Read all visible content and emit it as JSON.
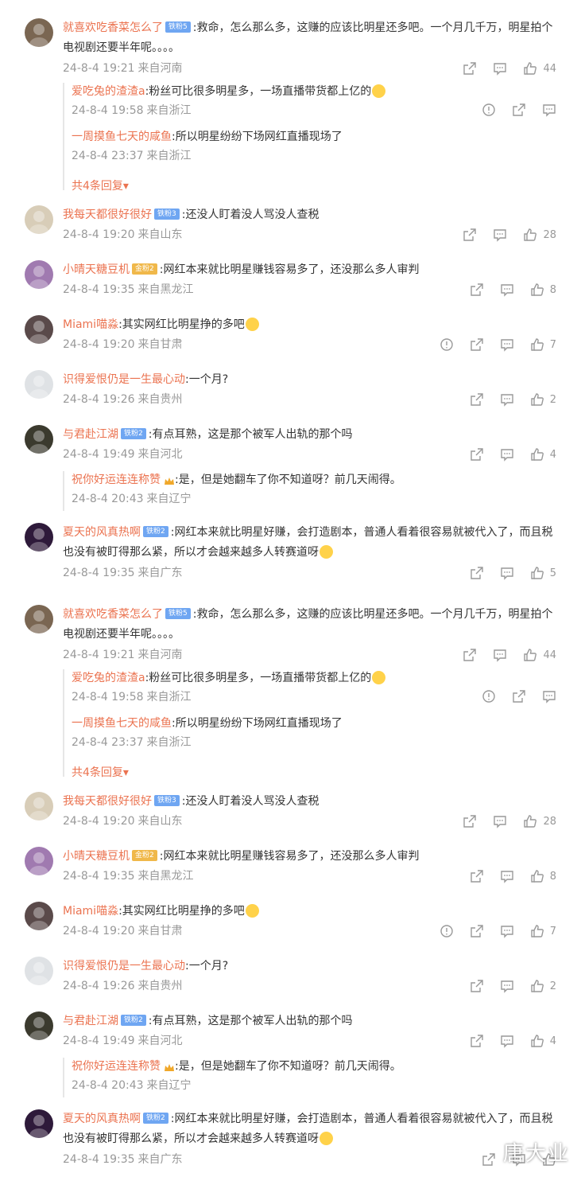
{
  "labels": {
    "more_replies": "共4条回复▾"
  },
  "blocks": [
    {
      "user": "就喜欢吃香菜怎么了",
      "badge": "铁粉5",
      "badge_type": "blue",
      "text": ":救命，怎么那么多，这赚的应该比明星还多吧。一个月几千万，明星拍个电视剧还要半年呢。。。。",
      "date": "24-8-4 19:21",
      "place": "来自河南",
      "likes": "44",
      "avatar_color": "#7a6652",
      "replies": [
        {
          "user": "爱吃兔的渣渣a",
          "text": ":粉丝可比很多明星多，一场直播带货都上亿的",
          "emoji": true,
          "date": "24-8-4 19:58",
          "place": "来自浙江"
        },
        {
          "user": "一周摸鱼七天的咸鱼",
          "text": ":所以明星纷纷下场网红直播现场了",
          "date": "24-8-4 23:37",
          "place": "来自浙江"
        }
      ],
      "more": true
    },
    {
      "user": "我每天都很好很好",
      "badge": "铁粉3",
      "badge_type": "blue",
      "text": ":还没人盯着没人骂没人查税",
      "date": "24-8-4 19:20",
      "place": "来自山东",
      "likes": "28",
      "avatar_color": "#d8cdb8"
    },
    {
      "user": "小晴天糖豆机",
      "badge": "金粉2",
      "badge_type": "gold",
      "text": ":网红本来就比明星赚钱容易多了，还没那么多人审判",
      "date": "24-8-4 19:35",
      "place": "来自黑龙江",
      "likes": "8",
      "avatar_color": "#a07ab0"
    },
    {
      "user": "Miami喵淼",
      "text": ":其实网红比明星挣的多吧",
      "emoji": true,
      "date": "24-8-4 19:20",
      "place": "来自甘肃",
      "likes": "7",
      "avatar_color": "#5a4a4a"
    },
    {
      "user": "识得爱恨仍是一生最心动",
      "text": ":一个月?",
      "date": "24-8-4 19:26",
      "place": "来自贵州",
      "likes": "2",
      "avatar_color": "#dfe2e5"
    },
    {
      "user": "与君赴江湖",
      "badge": "铁粉2",
      "badge_type": "blue",
      "text": ":有点耳熟，这是那个被军人出轨的那个吗",
      "date": "24-8-4 19:49",
      "place": "来自河北",
      "likes": "4",
      "avatar_color": "#3b3a2e",
      "replies": [
        {
          "user": "祝你好运连连称赞",
          "crown": true,
          "text": ":是，但是她翻车了你不知道呀？前几天闹得。",
          "date": "24-8-4 20:43",
          "place": "来自辽宁"
        }
      ]
    },
    {
      "user": "夏天的风真热啊",
      "badge": "铁粉2",
      "badge_type": "blue",
      "text": ":网红本来就比明星好赚，会打造剧本，普通人看着很容易就被代入了，而且税也没有被盯得那么紧，所以才会越来越多人转赛道呀",
      "emoji": true,
      "date": "24-8-4 19:35",
      "place": "来自广东",
      "likes": "5",
      "avatar_color": "#2e1a3a"
    },
    {
      "user": "就喜欢吃香菜怎么了",
      "badge": "铁粉5",
      "badge_type": "blue",
      "text": ":救命，怎么那么多，这赚的应该比明星还多吧。一个月几千万，明星拍个电视剧还要半年呢。。。。",
      "date": "24-8-4 19:21",
      "place": "来自河南",
      "likes": "44",
      "avatar_color": "#7a6652",
      "replies": [
        {
          "user": "爱吃兔的渣渣a",
          "text": ":粉丝可比很多明星多，一场直播带货都上亿的",
          "emoji": true,
          "date": "24-8-4 19:58",
          "place": "来自浙江"
        },
        {
          "user": "一周摸鱼七天的咸鱼",
          "text": ":所以明星纷纷下场网红直播现场了",
          "date": "24-8-4 23:37",
          "place": "来自浙江"
        }
      ],
      "more": true
    },
    {
      "user": "我每天都很好很好",
      "badge": "铁粉3",
      "badge_type": "blue",
      "text": ":还没人盯着没人骂没人查税",
      "date": "24-8-4 19:20",
      "place": "来自山东",
      "likes": "28",
      "avatar_color": "#d8cdb8"
    },
    {
      "user": "小晴天糖豆机",
      "badge": "金粉2",
      "badge_type": "gold",
      "text": ":网红本来就比明星赚钱容易多了，还没那么多人审判",
      "date": "24-8-4 19:35",
      "place": "来自黑龙江",
      "likes": "8",
      "avatar_color": "#a07ab0"
    },
    {
      "user": "Miami喵淼",
      "text": ":其实网红比明星挣的多吧",
      "emoji": true,
      "date": "24-8-4 19:20",
      "place": "来自甘肃",
      "likes": "7",
      "avatar_color": "#5a4a4a"
    },
    {
      "user": "识得爱恨仍是一生最心动",
      "text": ":一个月?",
      "date": "24-8-4 19:26",
      "place": "来自贵州",
      "likes": "2",
      "avatar_color": "#dfe2e5"
    },
    {
      "user": "与君赴江湖",
      "badge": "铁粉2",
      "badge_type": "blue",
      "text": ":有点耳熟，这是那个被军人出轨的那个吗",
      "date": "24-8-4 19:49",
      "place": "来自河北",
      "likes": "4",
      "avatar_color": "#3b3a2e",
      "replies": [
        {
          "user": "祝你好运连连称赞",
          "crown": true,
          "text": ":是，但是她翻车了你不知道呀？前几天闹得。",
          "date": "24-8-4 20:43",
          "place": "来自辽宁"
        }
      ]
    },
    {
      "user": "夏天的风真热啊",
      "badge": "铁粉2",
      "badge_type": "blue",
      "text": ":网红本来就比明星好赚，会打造剧本，普通人看着很容易就被代入了，而且税也没有被盯得那么紧，所以才会越来越多人转赛道呀",
      "emoji": true,
      "date": "24-8-4 19:35",
      "place": "来自广东",
      "likes": "",
      "avatar_color": "#2e1a3a"
    }
  ],
  "watermark": "唐大业"
}
